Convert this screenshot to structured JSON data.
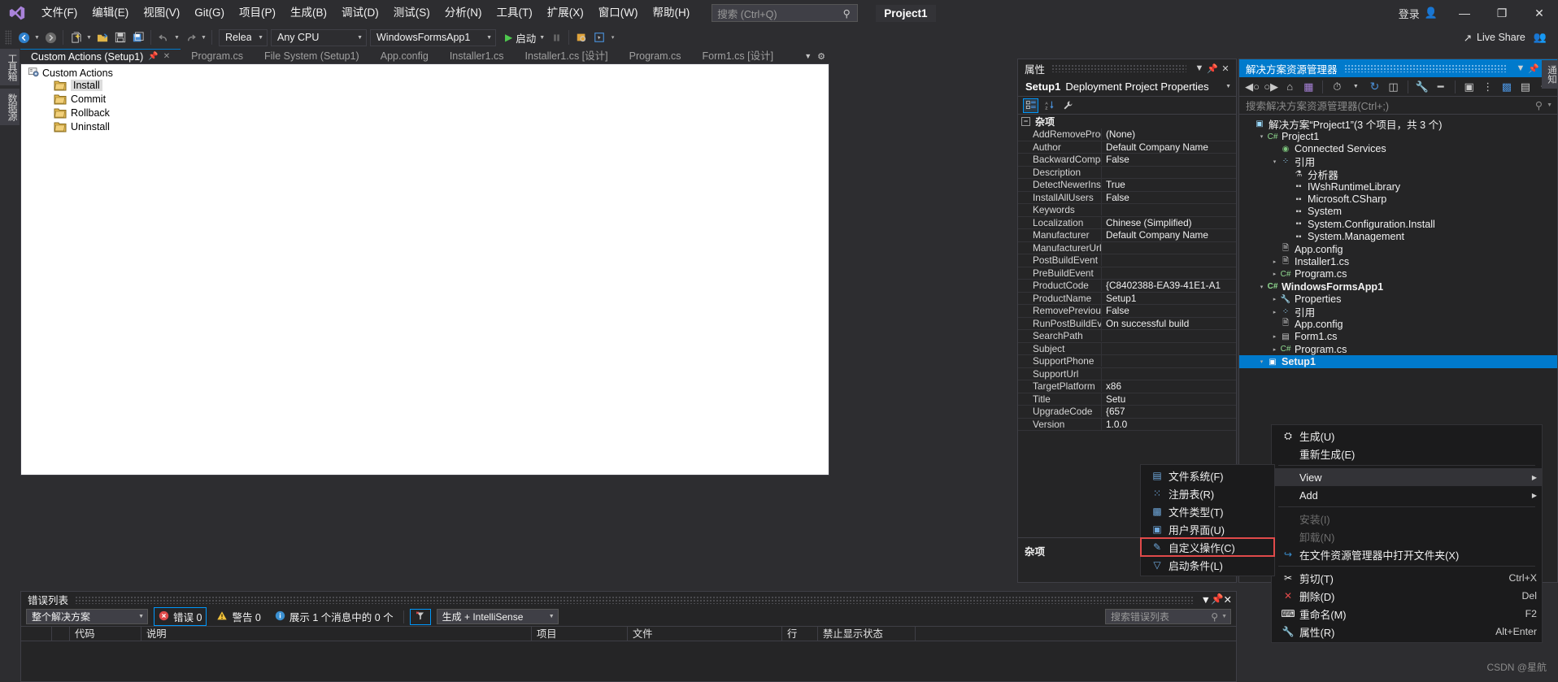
{
  "titlebar": {
    "menu": [
      {
        "label": "文件(F)"
      },
      {
        "label": "编辑(E)"
      },
      {
        "label": "视图(V)"
      },
      {
        "label": "Git(G)"
      },
      {
        "label": "项目(P)"
      },
      {
        "label": "生成(B)"
      },
      {
        "label": "调试(D)"
      },
      {
        "label": "测试(S)"
      },
      {
        "label": "分析(N)"
      },
      {
        "label": "工具(T)"
      },
      {
        "label": "扩展(X)"
      },
      {
        "label": "窗口(W)"
      },
      {
        "label": "帮助(H)"
      }
    ],
    "search_placeholder": "搜索 (Ctrl+Q)",
    "project_title": "Project1",
    "signin_label": "登录",
    "minimize": "—",
    "maximize": "❐",
    "close": "✕"
  },
  "toolbar": {
    "configuration": "Release",
    "platform": "Any CPU",
    "startup_project": "WindowsFormsApp1",
    "run_label": "启动",
    "live_share_label": "Live Share"
  },
  "vertical_tabs": [
    {
      "label": "工具箱"
    },
    {
      "label": "数据源"
    }
  ],
  "notification_tab": "通知",
  "editor_tabs": [
    {
      "label": "Custom Actions (Setup1)",
      "active": true
    },
    {
      "label": "Program.cs",
      "active": false
    },
    {
      "label": "File System (Setup1)",
      "active": false
    },
    {
      "label": "App.config",
      "active": false
    },
    {
      "label": "Installer1.cs",
      "active": false
    },
    {
      "label": "Installer1.cs [设计]",
      "active": false
    },
    {
      "label": "Program.cs",
      "active": false
    },
    {
      "label": "Form1.cs [设计]",
      "active": false
    }
  ],
  "custom_actions": {
    "root": "Custom Actions",
    "nodes": [
      {
        "label": "Install",
        "selected": true
      },
      {
        "label": "Commit",
        "selected": false
      },
      {
        "label": "Rollback",
        "selected": false
      },
      {
        "label": "Uninstall",
        "selected": false
      }
    ]
  },
  "properties": {
    "panel_title": "属性",
    "object_name": "Setup1",
    "object_type": "Deployment Project Properties",
    "group_label": "杂项",
    "description_title": "杂项",
    "rows": [
      {
        "name": "AddRemoveProg",
        "value": "(None)"
      },
      {
        "name": "Author",
        "value": "Default Company Name"
      },
      {
        "name": "BackwardCompа",
        "value": "False"
      },
      {
        "name": "Description",
        "value": ""
      },
      {
        "name": "DetectNewerInst",
        "value": "True"
      },
      {
        "name": "InstallAllUsers",
        "value": "False"
      },
      {
        "name": "Keywords",
        "value": ""
      },
      {
        "name": "Localization",
        "value": "Chinese (Simplified)"
      },
      {
        "name": "Manufacturer",
        "value": "Default Company Name"
      },
      {
        "name": "ManufacturerUrl",
        "value": ""
      },
      {
        "name": "PostBuildEvent",
        "value": ""
      },
      {
        "name": "PreBuildEvent",
        "value": ""
      },
      {
        "name": "ProductCode",
        "value": "{C8402388-EA39-41E1-A1"
      },
      {
        "name": "ProductName",
        "value": "Setup1"
      },
      {
        "name": "RemovePrevious",
        "value": "False"
      },
      {
        "name": "RunPostBuildEve",
        "value": "On successful build"
      },
      {
        "name": "SearchPath",
        "value": ""
      },
      {
        "name": "Subject",
        "value": ""
      },
      {
        "name": "SupportPhone",
        "value": ""
      },
      {
        "name": "SupportUrl",
        "value": ""
      },
      {
        "name": "TargetPlatform",
        "value": "x86"
      },
      {
        "name": "Title",
        "value": "Setu"
      },
      {
        "name": "UpgradeCode",
        "value": "{657"
      },
      {
        "name": "Version",
        "value": "1.0.0"
      }
    ]
  },
  "solution_explorer": {
    "panel_title": "解决方案资源管理器",
    "search_placeholder": "搜索解决方案资源管理器(Ctrl+;)",
    "tree": [
      {
        "label": "解决方案“Project1”(3 个项目，共 3 个)",
        "indent": 0,
        "arrow": "",
        "icon": "solution-icon",
        "icon_glyph": "▣",
        "color": "#9cdcfe",
        "bold": false,
        "selected": false
      },
      {
        "label": "Project1",
        "indent": 1,
        "arrow": "▾",
        "icon": "csharp-project-icon",
        "icon_glyph": "C#",
        "color": "#8fd98f",
        "bold": false,
        "selected": false
      },
      {
        "label": "Connected Services",
        "indent": 2,
        "arrow": "",
        "icon": "connected-services-icon",
        "icon_glyph": "◉",
        "color": "#7cc47c",
        "bold": false,
        "selected": false
      },
      {
        "label": "引用",
        "indent": 2,
        "arrow": "▾",
        "icon": "references-icon",
        "icon_glyph": "⁘",
        "color": "#9cdcfe",
        "bold": false,
        "selected": false
      },
      {
        "label": "分析器",
        "indent": 3,
        "arrow": "",
        "icon": "analyzer-icon",
        "icon_glyph": "⚗",
        "color": "#d0d0d0",
        "bold": false,
        "selected": false
      },
      {
        "label": "IWshRuntimeLibrary",
        "indent": 3,
        "arrow": "",
        "icon": "reference-icon",
        "icon_glyph": "▪▪",
        "color": "#c8c8c8",
        "bold": false,
        "selected": false
      },
      {
        "label": "Microsoft.CSharp",
        "indent": 3,
        "arrow": "",
        "icon": "reference-icon",
        "icon_glyph": "▪▪",
        "color": "#c8c8c8",
        "bold": false,
        "selected": false
      },
      {
        "label": "System",
        "indent": 3,
        "arrow": "",
        "icon": "reference-icon",
        "icon_glyph": "▪▪",
        "color": "#c8c8c8",
        "bold": false,
        "selected": false
      },
      {
        "label": "System.Configuration.Install",
        "indent": 3,
        "arrow": "",
        "icon": "reference-icon",
        "icon_glyph": "▪▪",
        "color": "#c8c8c8",
        "bold": false,
        "selected": false
      },
      {
        "label": "System.Management",
        "indent": 3,
        "arrow": "",
        "icon": "reference-icon",
        "icon_glyph": "▪▪",
        "color": "#c8c8c8",
        "bold": false,
        "selected": false
      },
      {
        "label": "App.config",
        "indent": 2,
        "arrow": "",
        "icon": "config-file-icon",
        "icon_glyph": "🗎",
        "color": "#c8c8c8",
        "bold": false,
        "selected": false
      },
      {
        "label": "Installer1.cs",
        "indent": 2,
        "arrow": "▸",
        "icon": "component-file-icon",
        "icon_glyph": "🗎",
        "color": "#c8c8c8",
        "bold": false,
        "selected": false
      },
      {
        "label": "Program.cs",
        "indent": 2,
        "arrow": "▸",
        "icon": "csharp-file-icon",
        "icon_glyph": "C#",
        "color": "#8fd98f",
        "bold": false,
        "selected": false
      },
      {
        "label": "WindowsFormsApp1",
        "indent": 1,
        "arrow": "▾",
        "icon": "csharp-project-icon",
        "icon_glyph": "C#",
        "color": "#8fd98f",
        "bold": true,
        "selected": false
      },
      {
        "label": "Properties",
        "indent": 2,
        "arrow": "▸",
        "icon": "properties-icon",
        "icon_glyph": "🔧",
        "color": "#c8c8c8",
        "bold": false,
        "selected": false
      },
      {
        "label": "引用",
        "indent": 2,
        "arrow": "▸",
        "icon": "references-icon",
        "icon_glyph": "⁘",
        "color": "#9cdcfe",
        "bold": false,
        "selected": false
      },
      {
        "label": "App.config",
        "indent": 2,
        "arrow": "",
        "icon": "config-file-icon",
        "icon_glyph": "🗎",
        "color": "#c8c8c8",
        "bold": false,
        "selected": false
      },
      {
        "label": "Form1.cs",
        "indent": 2,
        "arrow": "▸",
        "icon": "form-file-icon",
        "icon_glyph": "▤",
        "color": "#c8c8c8",
        "bold": false,
        "selected": false
      },
      {
        "label": "Program.cs",
        "indent": 2,
        "arrow": "▸",
        "icon": "csharp-file-icon",
        "icon_glyph": "C#",
        "color": "#8fd98f",
        "bold": false,
        "selected": false
      },
      {
        "label": "Setup1",
        "indent": 1,
        "arrow": "▾",
        "icon": "setup-project-icon",
        "icon_glyph": "▣",
        "color": "#ffffff",
        "bold": true,
        "selected": true
      }
    ]
  },
  "context_menu": {
    "items": [
      {
        "label": "生成(U)",
        "icon": "build-icon",
        "icon_glyph": "⛭",
        "shortcut": "",
        "submenu": false,
        "disabled": false,
        "highlight": false,
        "separator_after": false
      },
      {
        "label": "重新生成(E)",
        "icon": "",
        "icon_glyph": "",
        "shortcut": "",
        "submenu": false,
        "disabled": false,
        "highlight": false,
        "separator_after": true
      },
      {
        "label": "View",
        "icon": "",
        "icon_glyph": "",
        "shortcut": "",
        "submenu": true,
        "disabled": false,
        "highlight": true,
        "separator_after": false
      },
      {
        "label": "Add",
        "icon": "",
        "icon_glyph": "",
        "shortcut": "",
        "submenu": true,
        "disabled": false,
        "highlight": false,
        "separator_after": true
      },
      {
        "label": "安装(I)",
        "icon": "",
        "icon_glyph": "",
        "shortcut": "",
        "submenu": false,
        "disabled": true,
        "highlight": false,
        "separator_after": false
      },
      {
        "label": "卸载(N)",
        "icon": "",
        "icon_glyph": "",
        "shortcut": "",
        "submenu": false,
        "disabled": true,
        "highlight": false,
        "separator_after": false
      },
      {
        "label": "在文件资源管理器中打开文件夹(X)",
        "icon": "open-folder-icon",
        "icon_glyph": "↪",
        "shortcut": "",
        "submenu": false,
        "disabled": false,
        "highlight": false,
        "separator_after": true
      },
      {
        "label": "剪切(T)",
        "icon": "cut-icon",
        "icon_glyph": "✂",
        "shortcut": "Ctrl+X",
        "submenu": false,
        "disabled": false,
        "highlight": false,
        "separator_after": false
      },
      {
        "label": "删除(D)",
        "icon": "delete-icon",
        "icon_glyph": "✕",
        "shortcut": "Del",
        "submenu": false,
        "disabled": false,
        "highlight": false,
        "separator_after": false
      },
      {
        "label": "重命名(M)",
        "icon": "rename-icon",
        "icon_glyph": "⌨",
        "shortcut": "F2",
        "submenu": false,
        "disabled": false,
        "highlight": false,
        "separator_after": false
      },
      {
        "label": "属性(R)",
        "icon": "properties-icon",
        "icon_glyph": "🔧",
        "shortcut": "Alt+Enter",
        "submenu": false,
        "disabled": false,
        "highlight": false,
        "separator_after": false
      }
    ]
  },
  "view_submenu": {
    "items": [
      {
        "label": "文件系统(F)",
        "icon": "file-system-icon",
        "highlight": false
      },
      {
        "label": "注册表(R)",
        "icon": "registry-icon",
        "highlight": false
      },
      {
        "label": "文件类型(T)",
        "icon": "file-types-icon",
        "highlight": false
      },
      {
        "label": "用户界面(U)",
        "icon": "user-interface-icon",
        "highlight": false
      },
      {
        "label": "自定义操作(C)",
        "icon": "custom-actions-icon",
        "highlight": true
      },
      {
        "label": "启动条件(L)",
        "icon": "launch-conditions-icon",
        "highlight": false
      }
    ]
  },
  "error_list": {
    "panel_title": "错误列表",
    "scope_filter": "整个解决方案",
    "errors_label": "错误 0",
    "warnings_label": "警告 0",
    "messages_label": "展示 1 个消息中的 0 个",
    "build_filter": "生成 + IntelliSense",
    "search_placeholder": "搜索错误列表",
    "columns": [
      "代码",
      "说明",
      "项目",
      "文件",
      "行",
      "禁止显示状态"
    ]
  },
  "watermark": "CSDN @星航",
  "colors": {
    "accent": "#007acc",
    "background": "#2d2d30",
    "panel": "#252526",
    "menu": "#1b1b1c",
    "highlight_red": "#e04a4a",
    "green": "#4ec94e"
  }
}
